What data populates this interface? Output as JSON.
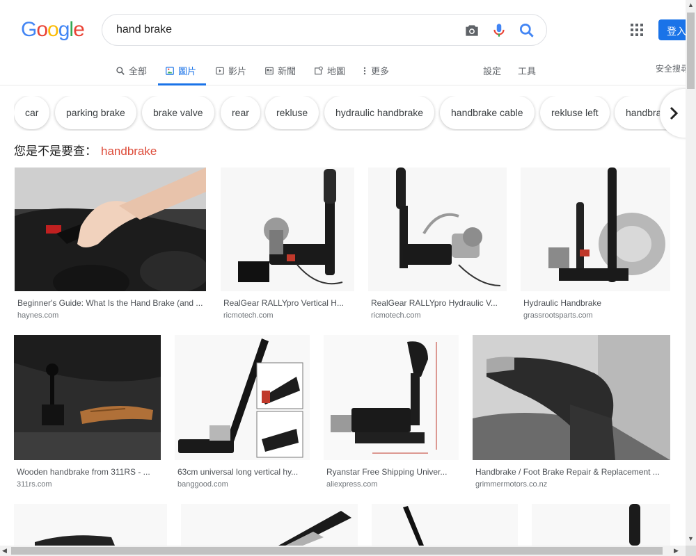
{
  "search": {
    "query": "hand brake"
  },
  "header": {
    "signin_label": "登入",
    "logo_colors": [
      "#4285F4",
      "#EA4335",
      "#FBBC05",
      "#4285F4",
      "#34A853",
      "#EA4335"
    ]
  },
  "tabs": [
    {
      "label": "全部",
      "icon": "search-icon"
    },
    {
      "label": "圖片",
      "icon": "image-icon",
      "active": true
    },
    {
      "label": "影片",
      "icon": "video-icon"
    },
    {
      "label": "新聞",
      "icon": "news-icon"
    },
    {
      "label": "地圖",
      "icon": "map-icon"
    },
    {
      "label": "更多",
      "icon": "more-vert-icon"
    }
  ],
  "tools": {
    "settings": "設定",
    "tools": "工具",
    "safesearch": "安全搜尋"
  },
  "chips": [
    "car",
    "parking brake",
    "brake valve",
    "rear",
    "rekluse",
    "hydraulic handbrake",
    "handbrake cable",
    "rekluse left",
    "handbrake"
  ],
  "did_you_mean": {
    "prefix": "您是不是要查：",
    "suggestion": "handbrake"
  },
  "results": [
    {
      "title": "Beginner's Guide: What Is the Hand Brake (and ...",
      "site": "haynes.com"
    },
    {
      "title": "RealGear RALLYpro Vertical H...",
      "site": "ricmotech.com"
    },
    {
      "title": "RealGear RALLYpro Hydraulic V...",
      "site": "ricmotech.com"
    },
    {
      "title": "Hydraulic Handbrake",
      "site": "grassrootsparts.com"
    },
    {
      "title": "Wooden handbrake from 311RS - ...",
      "site": "311rs.com"
    },
    {
      "title": "63cm universal long vertical hy...",
      "site": "banggood.com"
    },
    {
      "title": "Ryanstar Free Shipping Univer...",
      "site": "aliexpress.com"
    },
    {
      "title": "Handbrake / Foot Brake Repair & Replacement ...",
      "site": "grimmermotors.co.nz"
    }
  ],
  "colors": {
    "accent": "#1a73e8",
    "suggestion": "#dd4b39"
  }
}
